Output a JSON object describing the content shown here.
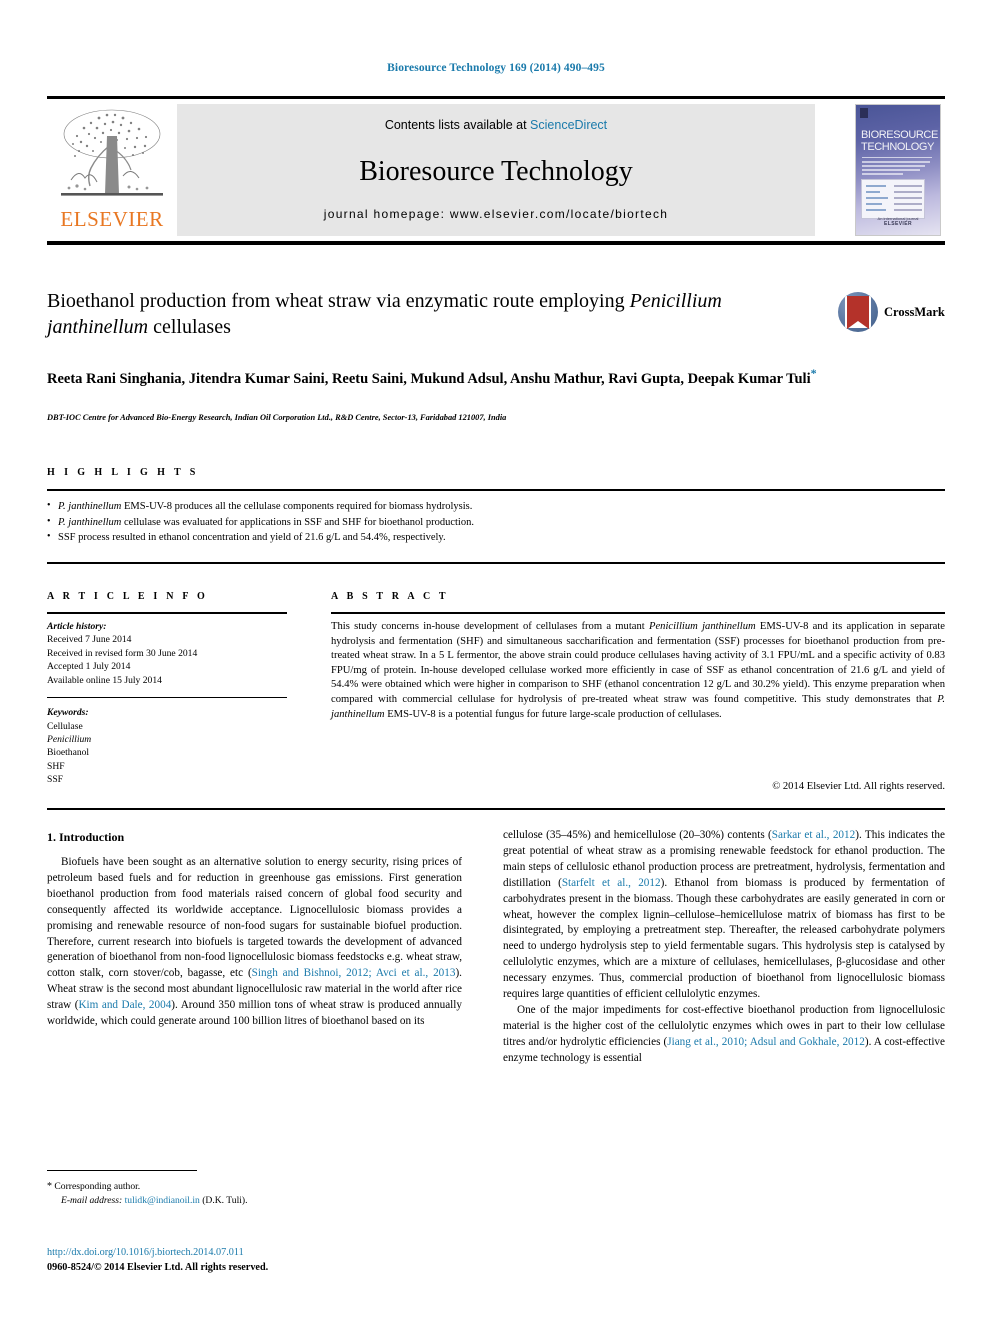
{
  "running_head": "Bioresource Technology 169 (2014) 490–495",
  "masthead": {
    "contents_prefix": "Contents lists available at ",
    "sciencedirect": "ScienceDirect",
    "journal_title": "Bioresource Technology",
    "homepage": "journal homepage: www.elsevier.com/locate/biortech",
    "publisher": "ELSEVIER",
    "cover": {
      "line1": "BIORESOURCE",
      "line2": "TECHNOLOGY",
      "footer_top": "An international journal",
      "footer_brand": "ELSEVIER"
    }
  },
  "article": {
    "title_line1": "Bioethanol production from wheat straw via enzymatic route employing",
    "title_italic": "Penicillium janthinellum",
    "title_line2_rest": " cellulases",
    "crossmark_label": "CrossMark",
    "authors": "Reeta Rani Singhania, Jitendra Kumar Saini, Reetu Saini, Mukund Adsul, Anshu Mathur, Ravi Gupta, Deepak Kumar Tuli",
    "corresponding_marker": "*",
    "affiliation": "DBT-IOC Centre for Advanced Bio-Energy Research, Indian Oil Corporation Ltd., R&D Centre, Sector-13, Faridabad 121007, India"
  },
  "highlights": {
    "heading": "H I G H L I G H T S",
    "items": [
      {
        "italic": "P. janthinellum",
        "rest": " EMS-UV-8 produces all the cellulase components required for biomass hydrolysis."
      },
      {
        "italic": "P. janthinellum",
        "rest": " cellulase was evaluated for applications in SSF and SHF for bioethanol production."
      },
      {
        "italic": "",
        "rest": "SSF process resulted in ethanol concentration and yield of 21.6 g/L and 54.4%, respectively."
      }
    ]
  },
  "article_info": {
    "heading": "A R T I C L E    I N F O",
    "history_label": "Article history:",
    "history": [
      "Received 7 June 2014",
      "Received in revised form 30 June 2014",
      "Accepted 1 July 2014",
      "Available online 15 July 2014"
    ],
    "keywords_label": "Keywords:",
    "keywords": [
      "Cellulase",
      "Penicillium",
      "Bioethanol",
      "SHF",
      "SSF"
    ],
    "keyword_italic_index": 1
  },
  "abstract": {
    "heading": "A B S T R A C T",
    "part1": "This study concerns in-house development of cellulases from a mutant ",
    "organism1": "Penicillium janthinellum",
    "part2": " EMS-UV-8 and its application in separate hydrolysis and fermentation (SHF) and simultaneous saccharification and fermentation (SSF) processes for bioethanol production from pre-treated wheat straw. In a 5 L fermentor, the above strain could produce cellulases having activity of 3.1 FPU/mL and a specific activity of 0.83 FPU/mg of protein. In-house developed cellulase worked more efficiently in case of SSF as ethanol concentration of 21.6 g/L and yield of 54.4% were obtained which were higher in comparison to SHF (ethanol concentration 12 g/L and 30.2% yield). This enzyme preparation when compared with commercial cellulase for hydrolysis of pre-treated wheat straw was found competitive. This study demonstrates that ",
    "organism2": "P. janthinellum",
    "part3": " EMS-UV-8 is a potential fungus for future large-scale production of cellulases.",
    "copyright": "© 2014 Elsevier Ltd. All rights reserved."
  },
  "body": {
    "section_heading": "1. Introduction",
    "left_p1_a": "Biofuels have been sought as an alternative solution to energy security, rising prices of petroleum based fuels and for reduction in greenhouse gas emissions. First generation bioethanol production from food materials raised concern of global food security and consequently affected its worldwide acceptance. Lignocellulosic biomass provides a promising and renewable resource of non-food sugars for sustainable biofuel production. Therefore, current research into biofuels is targeted towards the development of advanced generation of bioethanol from non-food lignocellulosic biomass feedstocks e.g. wheat straw, cotton stalk, corn stover/cob, bagasse, etc (",
    "left_ref1": "Singh and Bishnoi, 2012; Avci et al., 2013",
    "left_p1_b": "). Wheat straw is the second most abundant lignocellulosic raw material in the world after rice straw (",
    "left_ref2": "Kim and Dale, 2004",
    "left_p1_c": "). Around 350 million tons of wheat straw is produced annually worldwide, which could generate around 100 billion litres of bioethanol based on its",
    "right_p1_a": "cellulose (35–45%) and hemicellulose (20–30%) contents (",
    "right_ref1": "Sarkar et al., 2012",
    "right_p1_b": "). This indicates the great potential of wheat straw as a promising renewable feedstock for ethanol production. The main steps of cellulosic ethanol production process are pretreatment, hydrolysis, fermentation and distillation (",
    "right_ref2": "Starfelt et al., 2012",
    "right_p1_c": "). Ethanol from biomass is produced by fermentation of carbohydrates present in the biomass. Though these carbohydrates are easily generated in corn or wheat, however the complex lignin–cellulose–hemicellulose matrix of biomass has first to be disintegrated, by employing a pretreatment step. Thereafter, the released carbohydrate polymers need to undergo hydrolysis step to yield fermentable sugars. This hydrolysis step is catalysed by cellulolytic enzymes, which are a mixture of cellulases, hemicellulases, β-glucosidase and other necessary enzymes. Thus, commercial production of bioethanol from lignocellulosic biomass requires large quantities of efficient cellulolytic enzymes.",
    "right_p2_a": "One of the major impediments for cost-effective bioethanol production from lignocellulosic material is the higher cost of the cellulolytic enzymes which owes in part to their low cellulase titres and/or hydrolytic efficiencies (",
    "right_ref3": "Jiang et al., 2010; Adsul and Gokhale, 2012",
    "right_p2_b": "). A cost-effective enzyme technology is essential"
  },
  "footer": {
    "corresponding_star": "*",
    "corresponding_text": " Corresponding author.",
    "email_label": "E-mail address:",
    "email": "tulidk@indianoil.in",
    "email_owner": " (D.K. Tuli).",
    "doi": "http://dx.doi.org/10.1016/j.biortech.2014.07.011",
    "issn_line": "0960-8524/© 2014 Elsevier Ltd. All rights reserved."
  },
  "colors": {
    "link": "#1a7aab",
    "elsevier_orange": "#e87722",
    "crossmark_red": "#b4322a"
  }
}
